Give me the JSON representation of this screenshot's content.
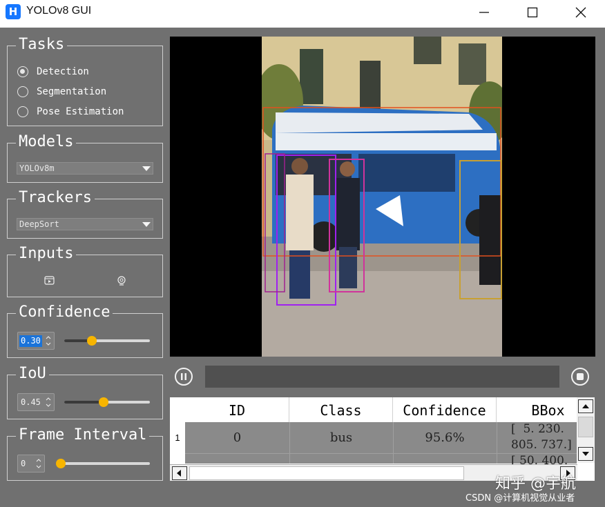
{
  "window": {
    "app_icon_letter": "H",
    "title": "YOLOv8 GUI"
  },
  "tasks": {
    "title": "Tasks",
    "options": [
      "Detection",
      "Segmentation",
      "Pose Estimation"
    ],
    "selected": "Detection"
  },
  "models": {
    "title": "Models",
    "selected": "YOLOv8m"
  },
  "trackers": {
    "title": "Trackers",
    "selected": "DeepSort"
  },
  "inputs": {
    "title": "Inputs",
    "icons": [
      "video-file-icon",
      "webcam-icon"
    ]
  },
  "confidence": {
    "title": "Confidence",
    "value": "0.30",
    "slider_fraction": 0.3
  },
  "iou": {
    "title": "IoU",
    "value": "0.45",
    "slider_fraction": 0.45
  },
  "frame_interval": {
    "title": "Frame Interval",
    "value": "0",
    "slider_fraction": 0
  },
  "player": {
    "progress_fraction": 0
  },
  "table": {
    "columns": [
      "ID",
      "Class",
      "Confidence",
      "BBox"
    ],
    "rows": [
      {
        "row_number": "1",
        "id": "0",
        "class": "bus",
        "confidence": "95.6%",
        "bbox_line1": "[  5. 230.",
        "bbox_line2": "805. 737.]"
      }
    ],
    "partial_next_row_bbox": "[ 50. 400."
  },
  "watermark": "知乎 @宇航",
  "credit": "CSDN @计算机视觉从业者"
}
